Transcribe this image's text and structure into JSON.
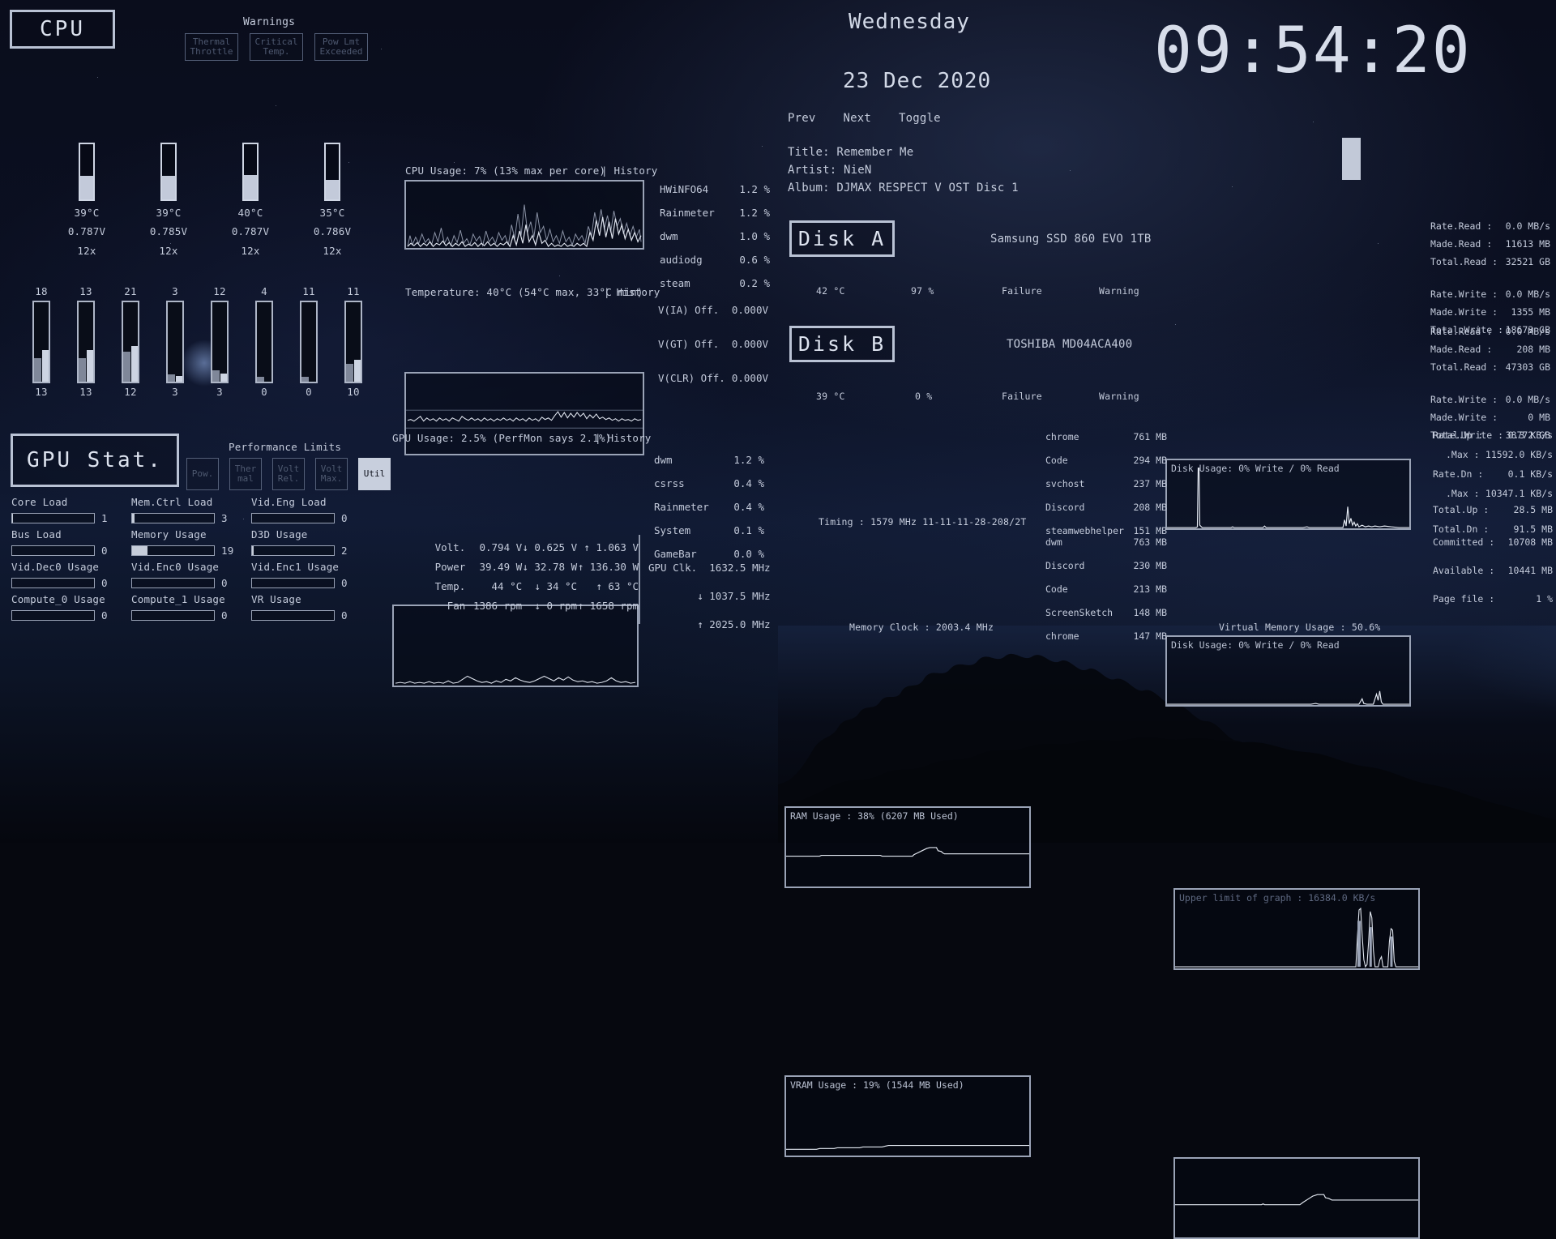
{
  "cpu": {
    "title": "CPU",
    "warnings_label": "Warnings",
    "warnings": [
      {
        "label": "Thermal\nThrottle",
        "active": false
      },
      {
        "label": "Critical\nTemp.",
        "active": false
      },
      {
        "label": "Pow Lmt\nExceeded",
        "active": false
      }
    ],
    "core_temps": [
      {
        "temp": "39°C",
        "volt": "0.787V",
        "mult": "12x",
        "fill": 42
      },
      {
        "temp": "39°C",
        "volt": "0.785V",
        "mult": "12x",
        "fill": 42
      },
      {
        "temp": "40°C",
        "volt": "0.787V",
        "mult": "12x",
        "fill": 44
      },
      {
        "temp": "35°C",
        "volt": "0.786V",
        "mult": "12x",
        "fill": 35
      }
    ],
    "core_loads": [
      {
        "top": "18",
        "bottom": "13",
        "a": 30,
        "b": 40
      },
      {
        "top": "13",
        "bottom": "13",
        "a": 30,
        "b": 40
      },
      {
        "top": "21",
        "bottom": "12",
        "a": 38,
        "b": 45
      },
      {
        "top": "3",
        "bottom": "3",
        "a": 9,
        "b": 7
      },
      {
        "top": "12",
        "bottom": "3",
        "a": 14,
        "b": 10
      },
      {
        "top": "4",
        "bottom": "0",
        "a": 6,
        "b": 0
      },
      {
        "top": "11",
        "bottom": "0",
        "a": 6,
        "b": 0
      },
      {
        "top": "11",
        "bottom": "10",
        "a": 22,
        "b": 28
      }
    ],
    "usage_header": "CPU Usage: 7% (13% max per core)",
    "usage_history": "| History",
    "temp_header": "Temperature: 40°C (54°C max, 33°C min)",
    "temp_history": "| History",
    "processes": [
      {
        "name": "HWiNFO64",
        "value": "1.2 %"
      },
      {
        "name": "Rainmeter",
        "value": "1.2 %"
      },
      {
        "name": "dwm",
        "value": "1.0 %"
      },
      {
        "name": "audiodg",
        "value": "0.6 %"
      },
      {
        "name": "steam",
        "value": "0.2 %"
      }
    ],
    "voltages": [
      {
        "name": "V(IA) Off.",
        "value": "0.000V"
      },
      {
        "name": "V(GT) Off.",
        "value": "0.000V"
      },
      {
        "name": "V(CLR) Off.",
        "value": "0.000V"
      }
    ]
  },
  "gpu": {
    "title": "GPU Stat.",
    "perf_limits_label": "Performance Limits",
    "perf_limits": [
      {
        "label": "Pow.",
        "active": false
      },
      {
        "label": "Ther\nmal",
        "active": false
      },
      {
        "label": "Volt\nRel.",
        "active": false
      },
      {
        "label": "Volt\nMax.",
        "active": false
      },
      {
        "label": "Util",
        "active": true
      }
    ],
    "meters": [
      {
        "label": "Core Load",
        "value": "1",
        "pct": 1
      },
      {
        "label": "Mem.Ctrl Load",
        "value": "3",
        "pct": 3
      },
      {
        "label": "Vid.Eng Load",
        "value": "0",
        "pct": 0
      },
      {
        "label": "Bus Load",
        "value": "0",
        "pct": 0
      },
      {
        "label": "Memory Usage",
        "value": "19",
        "pct": 19
      },
      {
        "label": "D3D Usage",
        "value": "2",
        "pct": 2
      },
      {
        "label": "Vid.Dec0 Usage",
        "value": "0",
        "pct": 0
      },
      {
        "label": "Vid.Enc0 Usage",
        "value": "0",
        "pct": 0
      },
      {
        "label": "Vid.Enc1 Usage",
        "value": "0",
        "pct": 0
      },
      {
        "label": "Compute_0 Usage",
        "value": "0",
        "pct": 0
      },
      {
        "label": "Compute_1 Usage",
        "value": "0",
        "pct": 0
      },
      {
        "label": "VR Usage",
        "value": "0",
        "pct": 0
      }
    ],
    "usage_header": "GPU Usage: 2.5% (PerfMon says 2.1%)",
    "usage_history": "| History",
    "processes": [
      {
        "name": "dwm",
        "value": "1.2 %"
      },
      {
        "name": "csrss",
        "value": "0.4 %"
      },
      {
        "name": "Rainmeter",
        "value": "0.4 %"
      },
      {
        "name": "System",
        "value": "0.1 %"
      },
      {
        "name": "GameBar",
        "value": "0.0 %"
      }
    ],
    "stats": [
      {
        "label": "Volt.",
        "cur": "0.794 V",
        "min": "↓ 0.625 V",
        "max": "↑ 1.063 V"
      },
      {
        "label": "Power",
        "cur": "39.49 W",
        "min": "↓ 32.78 W",
        "max": "↑ 136.30 W"
      },
      {
        "label": "Temp.",
        "cur": "44 °C",
        "min": "↓ 34 °C",
        "max": "↑ 63 °C"
      },
      {
        "label": "Fan",
        "cur": "1386 rpm",
        "min": "↓ 0 rpm",
        "max": "↑ 1658 rpm"
      }
    ],
    "clock": {
      "label": "GPU Clk.",
      "cur": "1632.5 MHz",
      "min": "↓ 1037.5 MHz",
      "max": "↑ 2025.0 MHz"
    }
  },
  "clockwidget": {
    "weekday": "Wednesday",
    "date": "23 Dec 2020",
    "time": "09:54:20",
    "controls": [
      "Prev",
      "Next",
      "Toggle"
    ],
    "media": {
      "title": "Title: Remember Me",
      "artist": "Artist: NieN",
      "album": "Album: DJMAX RESPECT V OST Disc 1"
    }
  },
  "disks": [
    {
      "name": "Disk A",
      "model": "Samsung SSD 860 EVO 1TB",
      "temp": "42 °C",
      "health": "97 %",
      "failure": "Failure",
      "warning": "Warning",
      "graph_caption": "Disk Usage: 0% Write / 0% Read",
      "stats": [
        {
          "label": "Rate.Read :",
          "value": "0.0 MB/s"
        },
        {
          "label": "Made.Read :",
          "value": "11613 MB"
        },
        {
          "label": "Total.Read :",
          "value": "32521 GB"
        },
        {
          "label": "Rate.Write :",
          "value": "0.0 MB/s"
        },
        {
          "label": "Made.Write :",
          "value": "1355 MB"
        },
        {
          "label": "Total.Write :",
          "value": "18673 GB"
        }
      ]
    },
    {
      "name": "Disk B",
      "model": "TOSHIBA MD04ACA400",
      "temp": "39 °C",
      "health": "0 %",
      "failure": "Failure",
      "warning": "Warning",
      "graph_caption": "Disk Usage: 0% Write / 0% Read",
      "stats": [
        {
          "label": "Rate.Read :",
          "value": "0.0 MB/s"
        },
        {
          "label": "Made.Read :",
          "value": "208 MB"
        },
        {
          "label": "Total.Read :",
          "value": "47303 GB"
        },
        {
          "label": "Rate.Write :",
          "value": "0.0 MB/s"
        },
        {
          "label": "Made.Write :",
          "value": "0 MB"
        },
        {
          "label": "Total.Write :",
          "value": "38772 GB"
        }
      ]
    }
  ],
  "memory": {
    "ram_caption": "RAM Usage : 38% (6207 MB Used)",
    "ram_footer": "Timing : 1579 MHz 11-11-11-28-208/2T",
    "ram_processes": [
      {
        "name": "chrome",
        "value": "761 MB"
      },
      {
        "name": "Code",
        "value": "294 MB"
      },
      {
        "name": "svchost",
        "value": "237 MB"
      },
      {
        "name": "Discord",
        "value": "208 MB"
      },
      {
        "name": "steamwebhelper",
        "value": "151 MB"
      }
    ],
    "vram_caption": "VRAM Usage : 19% (1544 MB Used)",
    "vram_footer": "Memory Clock : 2003.4 MHz",
    "vram_processes": [
      {
        "name": "dwm",
        "value": "763 MB"
      },
      {
        "name": "Discord",
        "value": "230 MB"
      },
      {
        "name": "Code",
        "value": "213 MB"
      },
      {
        "name": "ScreenSketch",
        "value": "148 MB"
      },
      {
        "name": "chrome",
        "value": "147 MB"
      }
    ]
  },
  "network": {
    "graph_caption": "Upper limit of graph : 16384.0 KB/s",
    "stats": [
      {
        "label": "Rate.Up :",
        "value": "0.3 KB/s"
      },
      {
        "label": ".Max :",
        "value": "11592.0 KB/s"
      },
      {
        "label": "Rate.Dn :",
        "value": "0.1 KB/s"
      },
      {
        "label": ".Max :",
        "value": "10347.1 KB/s"
      }
    ],
    "totals": [
      {
        "label": "Total.Up :",
        "value": "28.5 MB"
      },
      {
        "label": "Total.Dn :",
        "value": "91.5 MB"
      }
    ]
  },
  "virtual_memory": {
    "footer": "Virtual Memory Usage : 50.6%",
    "stats": [
      {
        "label": "Committed :",
        "value": "10708 MB"
      },
      {
        "label": "Available :",
        "value": "10441 MB"
      },
      {
        "label": "Page file :",
        "value": "1 %"
      }
    ]
  }
}
